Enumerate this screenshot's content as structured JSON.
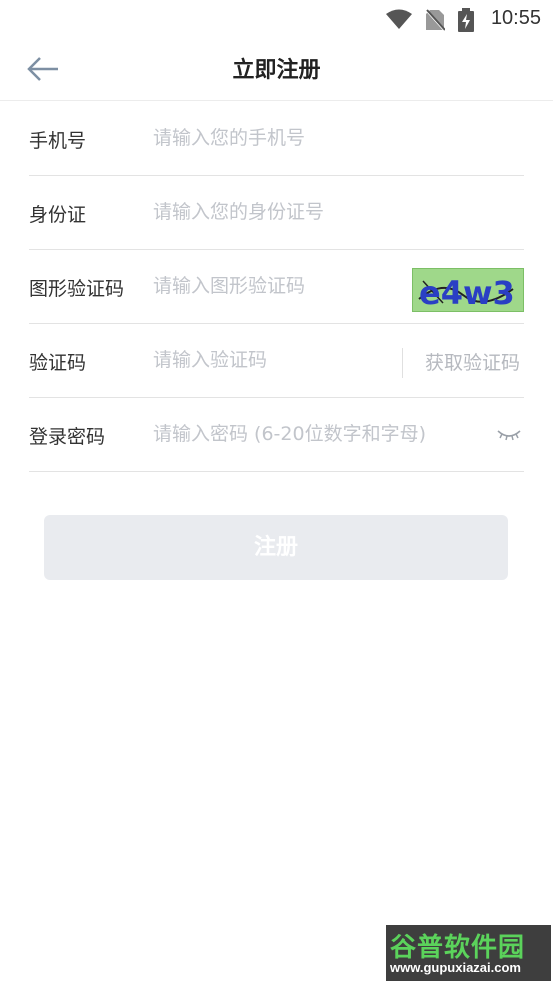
{
  "status_bar": {
    "time": "10:55",
    "icons": [
      "wifi-icon",
      "no-sim-icon",
      "battery-charging-icon"
    ]
  },
  "header": {
    "title": "立即注册",
    "back_icon": "arrow-left-icon"
  },
  "form": {
    "phone": {
      "label": "手机号",
      "placeholder": "请输入您的手机号",
      "value": ""
    },
    "id_card": {
      "label": "身份证",
      "placeholder": "请输入您的身份证号",
      "value": ""
    },
    "captcha": {
      "label": "图形验证码",
      "placeholder": "请输入图形验证码",
      "value": "",
      "image_text": "e4w3"
    },
    "sms_code": {
      "label": "验证码",
      "placeholder": "请输入验证码",
      "value": "",
      "get_code_label": "获取验证码"
    },
    "password": {
      "label": "登录密码",
      "placeholder": "请输入密码 (6-20位数字和字母)",
      "value": "",
      "toggle_icon": "eye-closed-icon"
    }
  },
  "submit": {
    "label": "注册",
    "enabled": false
  },
  "watermark": {
    "title": "谷普软件园",
    "url": "www.gupuxiazai.com"
  },
  "colors": {
    "placeholder": "#c2c5cb",
    "button_disabled_bg": "#e9ebef",
    "back_arrow": "#7d8fa3"
  }
}
